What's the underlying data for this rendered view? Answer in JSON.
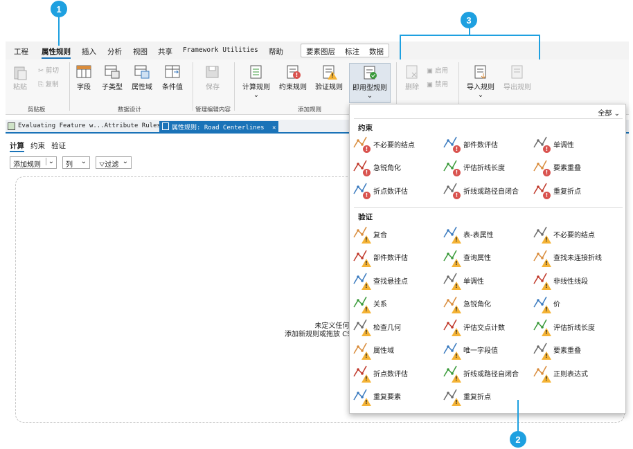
{
  "callouts": [
    "1",
    "2",
    "3"
  ],
  "menu": {
    "items": [
      "工程",
      "属性规则",
      "插入",
      "分析",
      "视图",
      "共享",
      "Framework Utilities",
      "帮助"
    ],
    "context_tabs": [
      "要素图层",
      "标注",
      "数据"
    ]
  },
  "ribbon": {
    "clipboard": {
      "paste": "粘贴",
      "cut": "剪切",
      "copy": "复制",
      "label": "剪贴板"
    },
    "data_design": {
      "fields": "字段",
      "subtypes": "子类型",
      "domains": "属性域",
      "contingent": "条件值",
      "label": "数据设计"
    },
    "manage_edits": {
      "save": "保存",
      "label": "管理编辑内容"
    },
    "add_rules": {
      "calc": "计算规则",
      "constraint": "约束规则",
      "validation": "验证规则",
      "quick": "即用型规则",
      "label": "添加规则"
    },
    "right": {
      "delete": "删除",
      "enable": "启用",
      "disable": "禁用",
      "import": "导入规则",
      "export": "导出规则"
    }
  },
  "doc_tabs": {
    "tab1": "Evaluating Feature w...Attribute Rules",
    "tab2_prefix": "属性规则:",
    "tab2_name": "Road Centerlines",
    "close": "✕"
  },
  "view": {
    "tabs": [
      "计算",
      "约束",
      "验证"
    ],
    "add_rule": "添加规则",
    "columns": "列",
    "filter": "过滤",
    "empty_line1": "未定义任何计",
    "empty_line2": "添加新规则或拖放 CSV"
  },
  "gallery": {
    "filter": "全部",
    "constraint_title": "约束",
    "constraint_items": [
      "不必要的结点",
      "部件数评估",
      "单调性",
      "急锐角化",
      "评估折线长度",
      "要素重叠",
      "折点数评估",
      "折线或路径自闭合",
      "重复折点"
    ],
    "validation_title": "验证",
    "validation_items": [
      "复合",
      "表-表属性",
      "不必要的结点",
      "部件数评估",
      "查询属性",
      "查找未连接折线",
      "查找悬挂点",
      "单调性",
      "非线性线段",
      "关系",
      "急锐角化",
      "价",
      "检查几何",
      "评估交点计数",
      "评估折线长度",
      "属性域",
      "唯一字段值",
      "要素重叠",
      "折点数评估",
      "折线或路径自闭合",
      "正则表达式",
      "重复要素",
      "重复折点"
    ]
  },
  "colors": {
    "accent": "#1a73b8",
    "callout": "#1ea0e0",
    "warning": "#f5b335",
    "error": "#d9534f"
  }
}
